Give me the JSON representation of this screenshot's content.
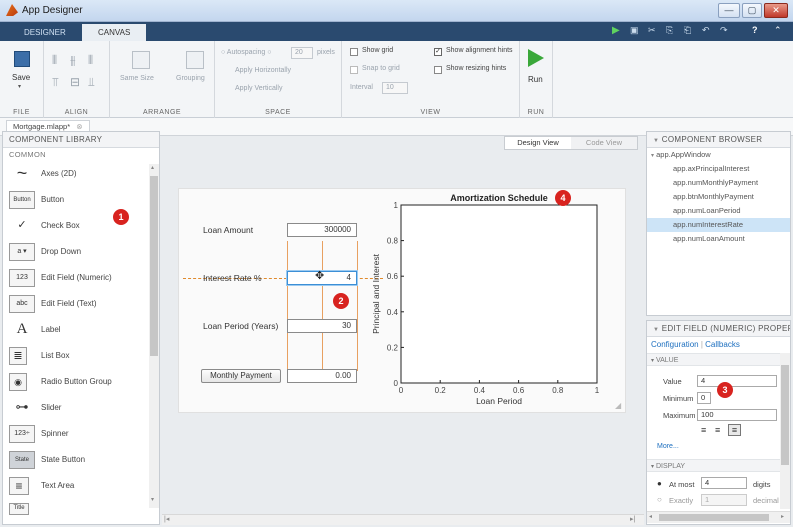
{
  "window": {
    "title": "App Designer",
    "min": "—",
    "max": "▢",
    "close": "✕"
  },
  "tabs": [
    {
      "label": "DESIGNER"
    },
    {
      "label": "CANVAS"
    }
  ],
  "quick_icons": [
    "▶",
    "▣",
    "✂",
    "⎘",
    "⎗",
    "↶",
    "↷",
    "?",
    "⌃"
  ],
  "ribbon": {
    "file": {
      "label": "FILE",
      "save": "Save"
    },
    "align": {
      "label": "ALIGN"
    },
    "arrange": {
      "label": "ARRANGE",
      "same_size": "Same Size",
      "grouping": "Grouping"
    },
    "space": {
      "label": "SPACE",
      "autospacing": "Autospacing",
      "spacing_value": "20",
      "pixels": "pixels",
      "apply_h": "Apply Horizontally",
      "apply_v": "Apply Vertically"
    },
    "view": {
      "label": "VIEW",
      "show_grid": "Show grid",
      "snap_to_grid": "Snap to grid",
      "interval": "Interval",
      "interval_value": "10",
      "show_alignment": "Show alignment hints",
      "show_resizing": "Show resizing hints"
    },
    "run": {
      "label": "RUN",
      "run": "Run"
    }
  },
  "document_tab": "Mortgage.mlapp*",
  "component_library": {
    "title": "COMPONENT LIBRARY",
    "section": "COMMON",
    "items": [
      {
        "icon": "~",
        "label": "Axes (2D)"
      },
      {
        "icon": "Button",
        "label": "Button"
      },
      {
        "icon": "✓",
        "label": "Check Box"
      },
      {
        "icon": "a ▾",
        "label": "Drop Down"
      },
      {
        "icon": "123",
        "label": "Edit Field (Numeric)"
      },
      {
        "icon": "abc",
        "label": "Edit Field (Text)"
      },
      {
        "icon": "A",
        "label": "Label"
      },
      {
        "icon": "≣",
        "label": "List Box"
      },
      {
        "icon": "◉",
        "label": "Radio Button Group"
      },
      {
        "icon": "⊶",
        "label": "Slider"
      },
      {
        "icon": "123÷",
        "label": "Spinner"
      },
      {
        "icon": "State",
        "label": "State Button"
      },
      {
        "icon": "≡",
        "label": "Text Area"
      },
      {
        "icon": "Title",
        "label": ""
      }
    ]
  },
  "view_toggle": {
    "design": "Design View",
    "code": "Code View"
  },
  "app": {
    "loan_amount_label": "Loan Amount",
    "loan_amount_value": "300000",
    "interest_label": "Interest Rate %",
    "interest_value": "4",
    "period_label": "Loan Period (Years)",
    "period_value": "30",
    "payment_button": "Monthly Payment",
    "payment_value": "0.00"
  },
  "chart_data": {
    "type": "line",
    "title": "Amortization Schedule",
    "xlabel": "Loan Period",
    "ylabel": "Principal and Interest",
    "xlim": [
      0,
      1
    ],
    "ylim": [
      0,
      1
    ],
    "xticks": [
      "0",
      "0.2",
      "0.4",
      "0.6",
      "0.8",
      "1"
    ],
    "yticks": [
      "0",
      "0.2",
      "0.4",
      "0.6",
      "0.8",
      "1"
    ],
    "series": []
  },
  "badges": [
    "1",
    "2",
    "3",
    "4"
  ],
  "component_browser": {
    "title": "COMPONENT BROWSER",
    "items": [
      {
        "label": "app.AppWindow",
        "selected": false
      },
      {
        "label": "app.axPrincipalInterest",
        "selected": false
      },
      {
        "label": "app.numMonthlyPayment",
        "selected": false
      },
      {
        "label": "app.btnMonthlyPayment",
        "selected": false
      },
      {
        "label": "app.numLoanPeriod",
        "selected": false
      },
      {
        "label": "app.numInterestRate",
        "selected": true
      },
      {
        "label": "app.numLoanAmount",
        "selected": false
      }
    ]
  },
  "inspector": {
    "title": "EDIT FIELD (NUMERIC) PROPER",
    "tab_config": "Configuration",
    "tab_callbacks": "Callbacks",
    "value_section": "VALUE",
    "value_label": "Value",
    "value": "4",
    "min_label": "Minimum",
    "min": "0",
    "max_label": "Maximum",
    "max": "100",
    "more": "More...",
    "display_section": "DISPLAY",
    "at_most_label": "At most",
    "at_most": "4",
    "digits": "digits",
    "exactly_label": "Exactly",
    "exactly": "1",
    "decimal_label": "decimal"
  }
}
